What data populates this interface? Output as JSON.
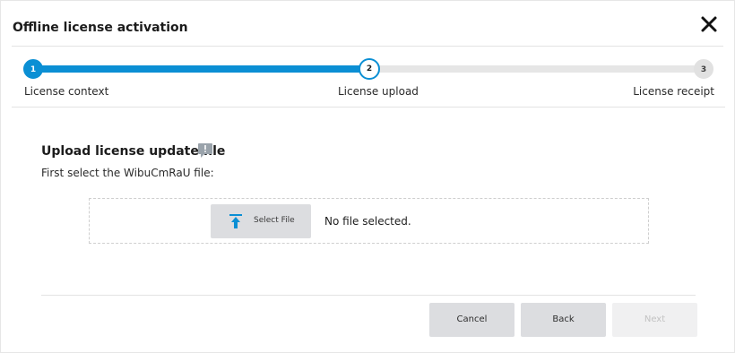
{
  "dialog": {
    "title": "Offline license activation",
    "close_icon": "close-icon"
  },
  "stepper": {
    "progress_fraction": 0.5,
    "active_color": "#0b8fd4",
    "steps": [
      {
        "number": "1",
        "label": "License context",
        "state": "done"
      },
      {
        "number": "2",
        "label": "License upload",
        "state": "active"
      },
      {
        "number": "3",
        "label": "License receipt",
        "state": "pending"
      }
    ]
  },
  "upload": {
    "title": "Upload license update file",
    "info_icon": "comment-info-icon",
    "instruction": "First select the WibuCmRaU file:",
    "select_button_label": "Select File",
    "upload_icon": "upload-arrow-icon",
    "file_status": "No file selected."
  },
  "footer": {
    "cancel_label": "Cancel",
    "back_label": "Back",
    "next_label": "Next",
    "next_enabled": false
  }
}
